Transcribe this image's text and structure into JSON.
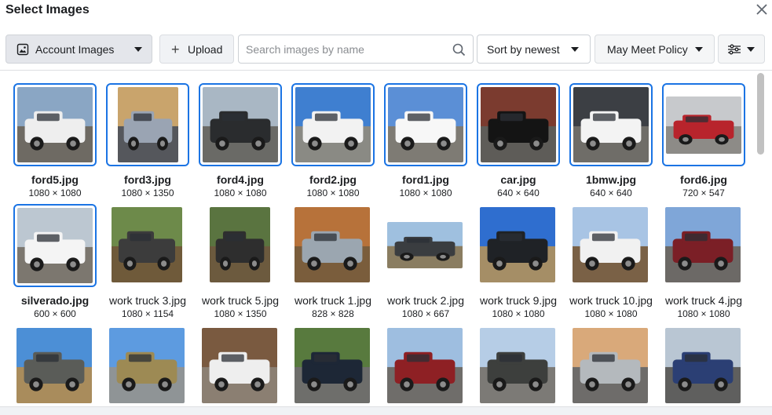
{
  "dialog": {
    "title": "Select Images"
  },
  "toolbar": {
    "account_label": "Account Images",
    "upload_label": "Upload",
    "search_placeholder": "Search images by name",
    "search_value": "",
    "sort_label": "Sort by newest",
    "policy_label": "May Meet Policy",
    "filter_icon": "sliders-icon"
  },
  "images": [
    {
      "name": "ford5.jpg",
      "dims": "1080 × 1080",
      "selected": true,
      "sky": "#8aa6c4",
      "ground": "#6e6a63",
      "body": "#eeeeee"
    },
    {
      "name": "ford3.jpg",
      "dims": "1080 × 1350",
      "selected": true,
      "sky": "#c9a46c",
      "ground": "#55575c",
      "body": "#9aa4b3"
    },
    {
      "name": "ford4.jpg",
      "dims": "1080 × 1080",
      "selected": true,
      "sky": "#a9b7c4",
      "ground": "#6a6a66",
      "body": "#2a2c2e"
    },
    {
      "name": "ford2.jpg",
      "dims": "1080 × 1080",
      "selected": true,
      "sky": "#3f7fd0",
      "ground": "#8a8a84",
      "body": "#f2f2f2"
    },
    {
      "name": "ford1.jpg",
      "dims": "1080 × 1080",
      "selected": true,
      "sky": "#5b8fd6",
      "ground": "#7e7b74",
      "body": "#f7f7f7"
    },
    {
      "name": "car.jpg",
      "dims": "640 × 640",
      "selected": true,
      "sky": "#7b3b2f",
      "ground": "#5e5c58",
      "body": "#141414"
    },
    {
      "name": "1bmw.jpg",
      "dims": "640 × 640",
      "selected": true,
      "sky": "#3c3f44",
      "ground": "#6f6d68",
      "body": "#f3f3f3"
    },
    {
      "name": "ford6.jpg",
      "dims": "720 × 547",
      "selected": true,
      "sky": "#c7c9cc",
      "ground": "#8d8b87",
      "body": "#b8242c"
    },
    {
      "name": "silverado.jpg",
      "dims": "600 × 600",
      "selected": true,
      "sky": "#bcc7d1",
      "ground": "#7c776f",
      "body": "#f4f4f4"
    },
    {
      "name": "work truck 3.jpg",
      "dims": "1080 × 1154",
      "selected": false,
      "sky": "#6d8a4a",
      "ground": "#6f5a3a",
      "body": "#3c3c3c"
    },
    {
      "name": "work truck 5.jpg",
      "dims": "1080 × 1350",
      "selected": false,
      "sky": "#5a7440",
      "ground": "#6c5a3e",
      "body": "#2e2e2e"
    },
    {
      "name": "work truck 1.jpg",
      "dims": "828 × 828",
      "selected": false,
      "sky": "#b7723a",
      "ground": "#7a5d3c",
      "body": "#9ba6b0"
    },
    {
      "name": "work truck 2.jpg",
      "dims": "1080 × 667",
      "selected": false,
      "sky": "#9fc0df",
      "ground": "#8a7d61",
      "body": "#3a3d40"
    },
    {
      "name": "work truck 9.jpg",
      "dims": "1080 × 1080",
      "selected": false,
      "sky": "#2f6ecf",
      "ground": "#a58e66",
      "body": "#1f2226"
    },
    {
      "name": "work truck 10.jpg",
      "dims": "1080 × 1080",
      "selected": false,
      "sky": "#a8c4e4",
      "ground": "#7a6146",
      "body": "#f1f1f1"
    },
    {
      "name": "work truck 4.jpg",
      "dims": "1080 × 1080",
      "selected": false,
      "sky": "#7fa6d8",
      "ground": "#6c6966",
      "body": "#7b1f26"
    },
    {
      "name": "",
      "dims": "",
      "selected": false,
      "sky": "#4c8fd6",
      "ground": "#a98c5c",
      "body": "#5a5c58"
    },
    {
      "name": "",
      "dims": "",
      "selected": false,
      "sky": "#5d9be0",
      "ground": "#8f9496",
      "body": "#9d8a54"
    },
    {
      "name": "",
      "dims": "",
      "selected": false,
      "sky": "#7a5a40",
      "ground": "#8b7f72",
      "body": "#eeeeee"
    },
    {
      "name": "",
      "dims": "",
      "selected": false,
      "sky": "#587a3e",
      "ground": "#6e6e6b",
      "body": "#1d2736"
    },
    {
      "name": "",
      "dims": "",
      "selected": false,
      "sky": "#9ebee0",
      "ground": "#6f6d6a",
      "body": "#8e2024"
    },
    {
      "name": "",
      "dims": "",
      "selected": false,
      "sky": "#b6cde6",
      "ground": "#7c7a76",
      "body": "#3d3f3d"
    },
    {
      "name": "",
      "dims": "",
      "selected": false,
      "sky": "#d9a97a",
      "ground": "#6e6c6a",
      "body": "#b4b9bd"
    },
    {
      "name": "",
      "dims": "",
      "selected": false,
      "sky": "#b9c6d3",
      "ground": "#5f5f5e",
      "body": "#2b3f74"
    }
  ],
  "colors": {
    "accent": "#1b74e4"
  }
}
